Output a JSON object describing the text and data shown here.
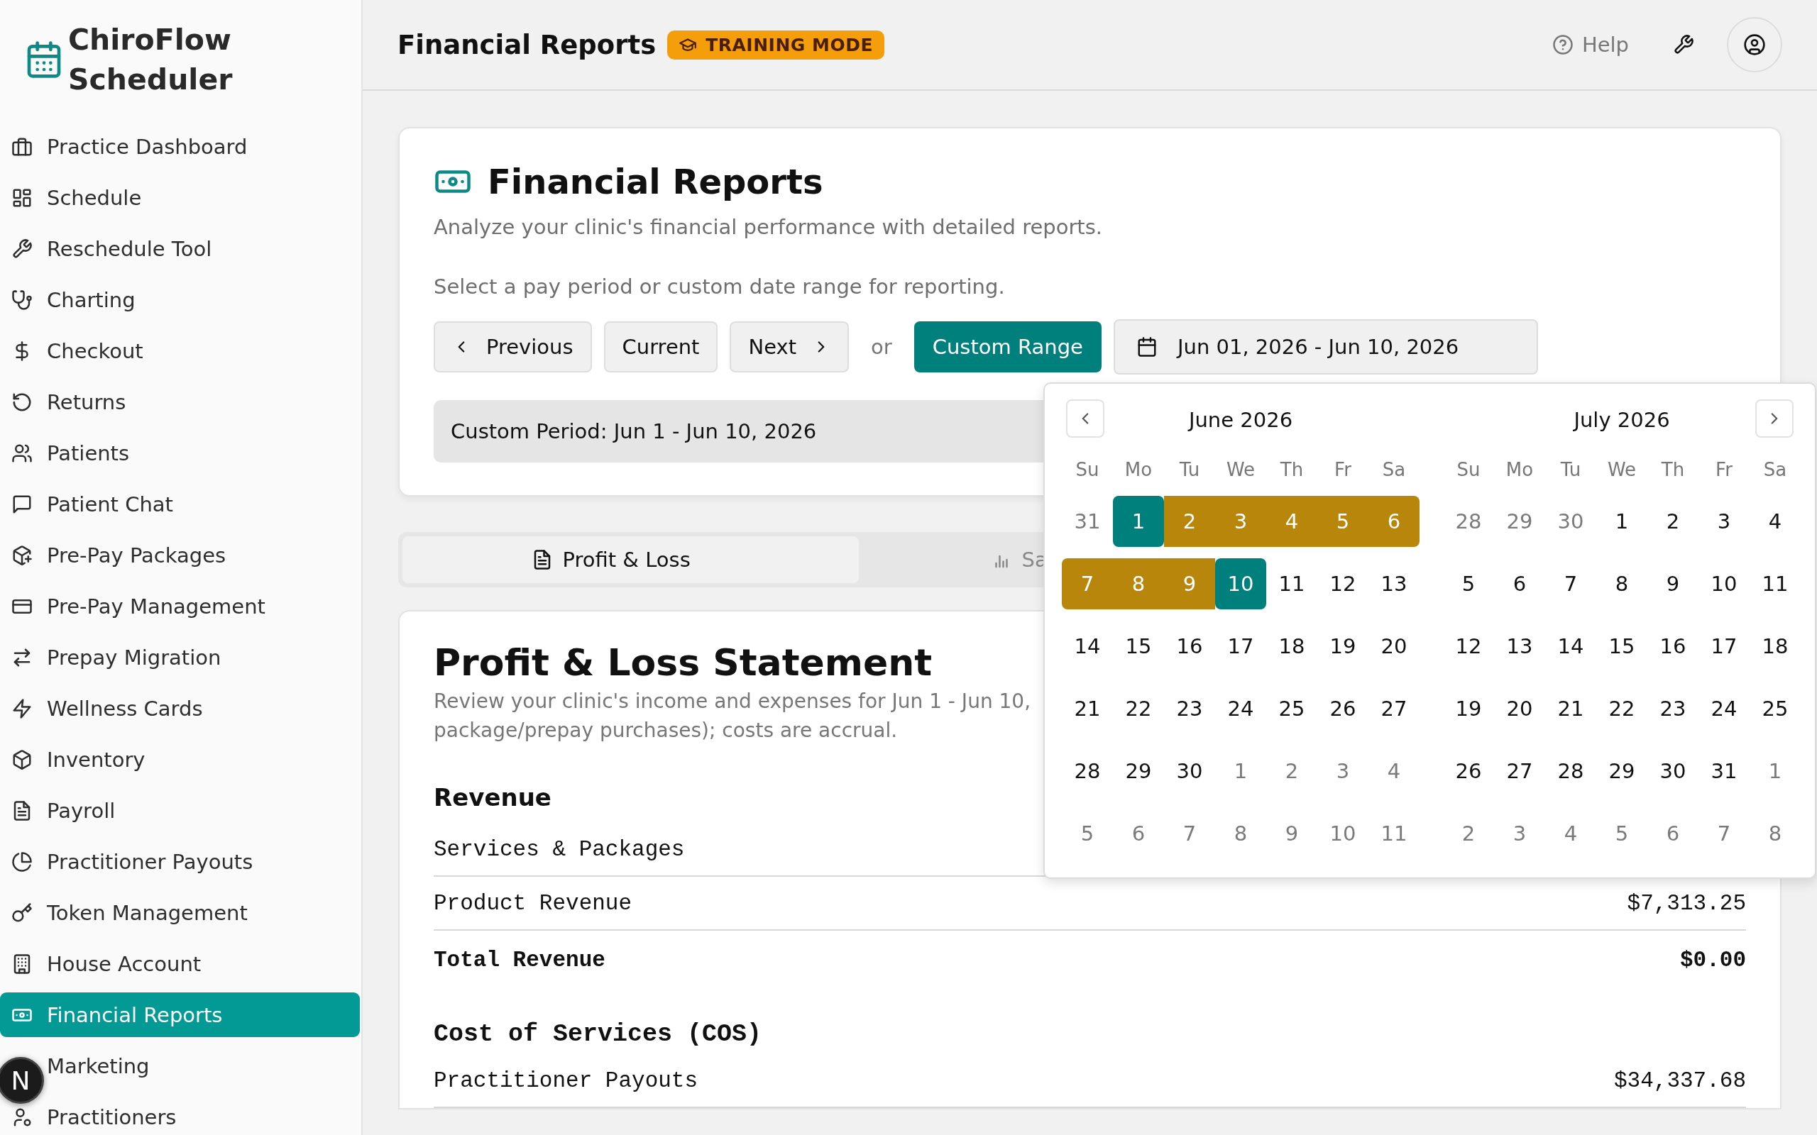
{
  "sidebar": {
    "app_name": "ChiroFlow Scheduler",
    "items": [
      {
        "label": "Practice Dashboard",
        "selected": false
      },
      {
        "label": "Schedule",
        "selected": false
      },
      {
        "label": "Reschedule Tool",
        "selected": false
      },
      {
        "label": "Charting",
        "selected": false
      },
      {
        "label": "Checkout",
        "selected": false
      },
      {
        "label": "Returns",
        "selected": false
      },
      {
        "label": "Patients",
        "selected": false
      },
      {
        "label": "Patient Chat",
        "selected": false
      },
      {
        "label": "Pre-Pay Packages",
        "selected": false
      },
      {
        "label": "Pre-Pay Management",
        "selected": false
      },
      {
        "label": "Prepay Migration",
        "selected": false
      },
      {
        "label": "Wellness Cards",
        "selected": false
      },
      {
        "label": "Inventory",
        "selected": false
      },
      {
        "label": "Payroll",
        "selected": false
      },
      {
        "label": "Practitioner Payouts",
        "selected": false
      },
      {
        "label": "Token Management",
        "selected": false
      },
      {
        "label": "House Account",
        "selected": false
      },
      {
        "label": "Financial Reports",
        "selected": true
      },
      {
        "label": "Marketing",
        "selected": false
      },
      {
        "label": "Practitioners",
        "selected": false
      }
    ]
  },
  "header": {
    "title": "Financial Reports",
    "badge": "TRAINING MODE",
    "help": "Help"
  },
  "period_card": {
    "title": "Financial Reports",
    "subtitle": "Analyze your clinic's financial performance with detailed reports.",
    "prompt": "Select a pay period or custom date range for reporting.",
    "buttons": [
      {
        "label": "Previous",
        "kind": "prev",
        "selected": false
      },
      {
        "label": "Current",
        "kind": "plain",
        "selected": false
      },
      {
        "label": "Next",
        "kind": "next",
        "selected": false
      }
    ],
    "separator": "or",
    "custom_button": {
      "label": "Custom Range",
      "selected": true
    },
    "date_range": "Jun 01, 2026 - Jun 10, 2026",
    "period_label": "Custom Period: Jun 1 - Jun 10, 2026"
  },
  "report_tabs": [
    {
      "label": "Profit & Loss",
      "kind": "document",
      "selected": true
    },
    {
      "label": "Sa",
      "kind": "chart",
      "selected": false
    }
  ],
  "statement": {
    "title": "Profit & Loss Statement",
    "description_lines": [
      "Review your clinic's income and expenses for Jun 1 - Jun 10,",
      "package/prepay purchases); costs are accrual."
    ],
    "sections": [
      {
        "heading": "Revenue",
        "rows": [
          {
            "label": "Services & Packages",
            "kind": "line"
          },
          {
            "label": "Product Revenue",
            "amount": "$7,313.25",
            "kind": "line"
          },
          {
            "label": "Total Revenue",
            "amount": "$0.00",
            "kind": "total"
          }
        ]
      },
      {
        "heading": "Cost of Services (COS)",
        "rows": [
          {
            "label": "Practitioner Payouts",
            "amount": "$34,337.68",
            "kind": "line"
          }
        ]
      }
    ]
  },
  "calendar": {
    "months": [
      {
        "title": "June 2026",
        "weekdays": [
          "Su",
          "Mo",
          "Tu",
          "We",
          "Th",
          "Fr",
          "Sa"
        ],
        "weeks": [
          [
            {
              "day": "31",
              "outside": true,
              "selected": false,
              "in_range": false
            },
            {
              "day": "1",
              "outside": false,
              "selected": true,
              "in_range": true
            },
            {
              "day": "2",
              "outside": false,
              "selected": false,
              "in_range": true
            },
            {
              "day": "3",
              "outside": false,
              "selected": false,
              "in_range": true
            },
            {
              "day": "4",
              "outside": false,
              "selected": false,
              "in_range": true
            },
            {
              "day": "5",
              "outside": false,
              "selected": false,
              "in_range": true
            },
            {
              "day": "6",
              "outside": false,
              "selected": false,
              "in_range": true
            }
          ],
          [
            {
              "day": "7",
              "outside": false,
              "selected": false,
              "in_range": true
            },
            {
              "day": "8",
              "outside": false,
              "selected": false,
              "in_range": true
            },
            {
              "day": "9",
              "outside": false,
              "selected": false,
              "in_range": true
            },
            {
              "day": "10",
              "outside": false,
              "selected": true,
              "in_range": true
            },
            {
              "day": "11",
              "outside": false,
              "selected": false,
              "in_range": false
            },
            {
              "day": "12",
              "outside": false,
              "selected": false,
              "in_range": false
            },
            {
              "day": "13",
              "outside": false,
              "selected": false,
              "in_range": false
            }
          ],
          [
            {
              "day": "14",
              "outside": false,
              "selected": false,
              "in_range": false
            },
            {
              "day": "15",
              "outside": false,
              "selected": false,
              "in_range": false
            },
            {
              "day": "16",
              "outside": false,
              "selected": false,
              "in_range": false
            },
            {
              "day": "17",
              "outside": false,
              "selected": false,
              "in_range": false
            },
            {
              "day": "18",
              "outside": false,
              "selected": false,
              "in_range": false
            },
            {
              "day": "19",
              "outside": false,
              "selected": false,
              "in_range": false
            },
            {
              "day": "20",
              "outside": false,
              "selected": false,
              "in_range": false
            }
          ],
          [
            {
              "day": "21",
              "outside": false,
              "selected": false,
              "in_range": false
            },
            {
              "day": "22",
              "outside": false,
              "selected": false,
              "in_range": false
            },
            {
              "day": "23",
              "outside": false,
              "selected": false,
              "in_range": false
            },
            {
              "day": "24",
              "outside": false,
              "selected": false,
              "in_range": false
            },
            {
              "day": "25",
              "outside": false,
              "selected": false,
              "in_range": false
            },
            {
              "day": "26",
              "outside": false,
              "selected": false,
              "in_range": false
            },
            {
              "day": "27",
              "outside": false,
              "selected": false,
              "in_range": false
            }
          ],
          [
            {
              "day": "28",
              "outside": false,
              "selected": false,
              "in_range": false
            },
            {
              "day": "29",
              "outside": false,
              "selected": false,
              "in_range": false
            },
            {
              "day": "30",
              "outside": false,
              "selected": false,
              "in_range": false
            },
            {
              "day": "1",
              "outside": true,
              "selected": false,
              "in_range": false
            },
            {
              "day": "2",
              "outside": true,
              "selected": false,
              "in_range": false
            },
            {
              "day": "3",
              "outside": true,
              "selected": false,
              "in_range": false
            },
            {
              "day": "4",
              "outside": true,
              "selected": false,
              "in_range": false
            }
          ],
          [
            {
              "day": "5",
              "outside": true,
              "selected": false,
              "in_range": false
            },
            {
              "day": "6",
              "outside": true,
              "selected": false,
              "in_range": false
            },
            {
              "day": "7",
              "outside": true,
              "selected": false,
              "in_range": false
            },
            {
              "day": "8",
              "outside": true,
              "selected": false,
              "in_range": false
            },
            {
              "day": "9",
              "outside": true,
              "selected": false,
              "in_range": false
            },
            {
              "day": "10",
              "outside": true,
              "selected": false,
              "in_range": false
            },
            {
              "day": "11",
              "outside": true,
              "selected": false,
              "in_range": false
            }
          ]
        ]
      },
      {
        "title": "July 2026",
        "weekdays": [
          "Su",
          "Mo",
          "Tu",
          "We",
          "Th",
          "Fr",
          "Sa"
        ],
        "weeks": [
          [
            {
              "day": "28",
              "outside": true,
              "selected": false,
              "in_range": false
            },
            {
              "day": "29",
              "outside": true,
              "selected": false,
              "in_range": false
            },
            {
              "day": "30",
              "outside": true,
              "selected": false,
              "in_range": false
            },
            {
              "day": "1",
              "outside": false,
              "selected": false,
              "in_range": false
            },
            {
              "day": "2",
              "outside": false,
              "selected": false,
              "in_range": false
            },
            {
              "day": "3",
              "outside": false,
              "selected": false,
              "in_range": false
            },
            {
              "day": "4",
              "outside": false,
              "selected": false,
              "in_range": false
            }
          ],
          [
            {
              "day": "5",
              "outside": false,
              "selected": false,
              "in_range": false
            },
            {
              "day": "6",
              "outside": false,
              "selected": false,
              "in_range": false
            },
            {
              "day": "7",
              "outside": false,
              "selected": false,
              "in_range": false
            },
            {
              "day": "8",
              "outside": false,
              "selected": false,
              "in_range": false
            },
            {
              "day": "9",
              "outside": false,
              "selected": false,
              "in_range": false
            },
            {
              "day": "10",
              "outside": false,
              "selected": false,
              "in_range": false
            },
            {
              "day": "11",
              "outside": false,
              "selected": false,
              "in_range": false
            }
          ],
          [
            {
              "day": "12",
              "outside": false,
              "selected": false,
              "in_range": false
            },
            {
              "day": "13",
              "outside": false,
              "selected": false,
              "in_range": false
            },
            {
              "day": "14",
              "outside": false,
              "selected": false,
              "in_range": false
            },
            {
              "day": "15",
              "outside": false,
              "selected": false,
              "in_range": false
            },
            {
              "day": "16",
              "outside": false,
              "selected": false,
              "in_range": false
            },
            {
              "day": "17",
              "outside": false,
              "selected": false,
              "in_range": false
            },
            {
              "day": "18",
              "outside": false,
              "selected": false,
              "in_range": false
            }
          ],
          [
            {
              "day": "19",
              "outside": false,
              "selected": false,
              "in_range": false
            },
            {
              "day": "20",
              "outside": false,
              "selected": false,
              "in_range": false
            },
            {
              "day": "21",
              "outside": false,
              "selected": false,
              "in_range": false
            },
            {
              "day": "22",
              "outside": false,
              "selected": false,
              "in_range": false
            },
            {
              "day": "23",
              "outside": false,
              "selected": false,
              "in_range": false
            },
            {
              "day": "24",
              "outside": false,
              "selected": false,
              "in_range": false
            },
            {
              "day": "25",
              "outside": false,
              "selected": false,
              "in_range": false
            }
          ],
          [
            {
              "day": "26",
              "outside": false,
              "selected": false,
              "in_range": false
            },
            {
              "day": "27",
              "outside": false,
              "selected": false,
              "in_range": false
            },
            {
              "day": "28",
              "outside": false,
              "selected": false,
              "in_range": false
            },
            {
              "day": "29",
              "outside": false,
              "selected": false,
              "in_range": false
            },
            {
              "day": "30",
              "outside": false,
              "selected": false,
              "in_range": false
            },
            {
              "day": "31",
              "outside": false,
              "selected": false,
              "in_range": false
            },
            {
              "day": "1",
              "outside": true,
              "selected": false,
              "in_range": false
            }
          ],
          [
            {
              "day": "2",
              "outside": true,
              "selected": false,
              "in_range": false
            },
            {
              "day": "3",
              "outside": true,
              "selected": false,
              "in_range": false
            },
            {
              "day": "4",
              "outside": true,
              "selected": false,
              "in_range": false
            },
            {
              "day": "5",
              "outside": true,
              "selected": false,
              "in_range": false
            },
            {
              "day": "6",
              "outside": true,
              "selected": false,
              "in_range": false
            },
            {
              "day": "7",
              "outside": true,
              "selected": false,
              "in_range": false
            },
            {
              "day": "8",
              "outside": true,
              "selected": false,
              "in_range": false
            }
          ]
        ]
      }
    ]
  },
  "dev_badge": "N"
}
